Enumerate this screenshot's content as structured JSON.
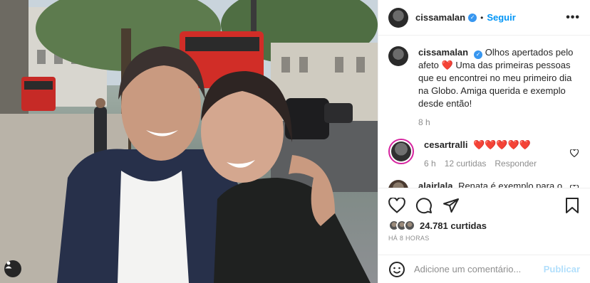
{
  "post": {
    "username": "cissamalan",
    "follow_label": "Seguir",
    "dot": "•",
    "more_label": "•••",
    "verified_mark": "✓"
  },
  "caption": {
    "username": "cissamalan",
    "text_before": "Olhos apertados pelo afeto",
    "heart": "❤️",
    "text_after": "Uma das primeiras pessoas que eu encontrei no meu primeiro dia na Globo. Amiga querida e exemplo desde então!",
    "time": "8 h"
  },
  "comments": [
    {
      "username": "cesartralli",
      "text": "❤️❤️❤️❤️❤️",
      "time": "6 h",
      "likes": "12 curtidas",
      "reply_label": "Responder"
    },
    {
      "username": "alairlala",
      "text": "Renata é exemplo para o"
    }
  ],
  "likes": {
    "count": "24.781",
    "label": "curtidas"
  },
  "post_time": "HÁ 8 HORAS",
  "comment_box": {
    "placeholder": "Adicione um comentário...",
    "publish_label": "Publicar"
  },
  "icons": [
    "heart-icon",
    "comment-icon",
    "share-icon",
    "bookmark-icon",
    "emoji-icon",
    "more-icon",
    "tag-user-icon"
  ],
  "colors": {
    "accent": "#0095f6",
    "verified": "#3897f0",
    "like": "#ed4956",
    "publish_disabled": "#b2dffc"
  }
}
